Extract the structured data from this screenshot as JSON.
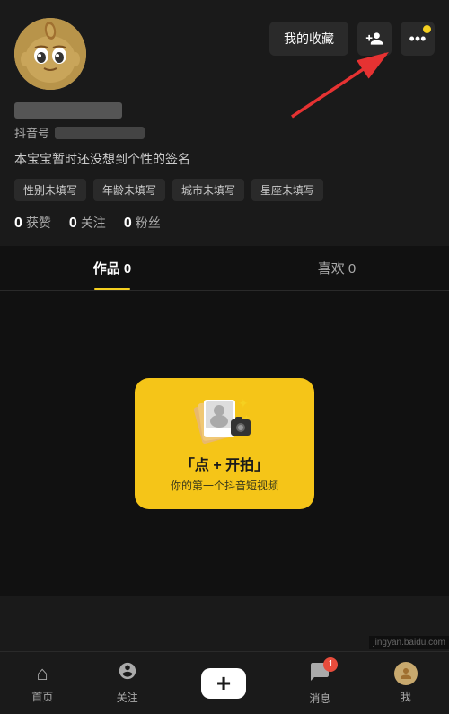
{
  "profile": {
    "username_blurred": true,
    "douyin_id_label": "抖音号",
    "bio": "本宝宝暂时还没想到个性的签名",
    "tags": [
      "性别未填写",
      "年龄未填写",
      "城市未填写",
      "星座未填写"
    ],
    "stats": {
      "likes": {
        "num": "0",
        "label": "获赞"
      },
      "following": {
        "num": "0",
        "label": "关注"
      },
      "followers": {
        "num": "0",
        "label": "粉丝"
      }
    }
  },
  "action_buttons": {
    "collect": "我的收藏",
    "add_friend": "＋👤",
    "more": "···"
  },
  "tabs": [
    {
      "id": "works",
      "label": "作品 0",
      "active": true
    },
    {
      "id": "likes",
      "label": "喜欢 0",
      "active": false
    }
  ],
  "cta": {
    "title": "「点 + 开拍」",
    "subtitle": "你的第一个抖音短视频"
  },
  "bottom_nav": [
    {
      "id": "home",
      "label": "首页",
      "icon": "🏠"
    },
    {
      "id": "follow",
      "label": "关注",
      "icon": "👥"
    },
    {
      "id": "add",
      "label": "",
      "icon": "+"
    },
    {
      "id": "message",
      "label": "消息",
      "icon": "💬",
      "badge": "1"
    },
    {
      "id": "me",
      "label": "我",
      "icon": "👤"
    }
  ],
  "watermark": "jingyan.baidu.com"
}
